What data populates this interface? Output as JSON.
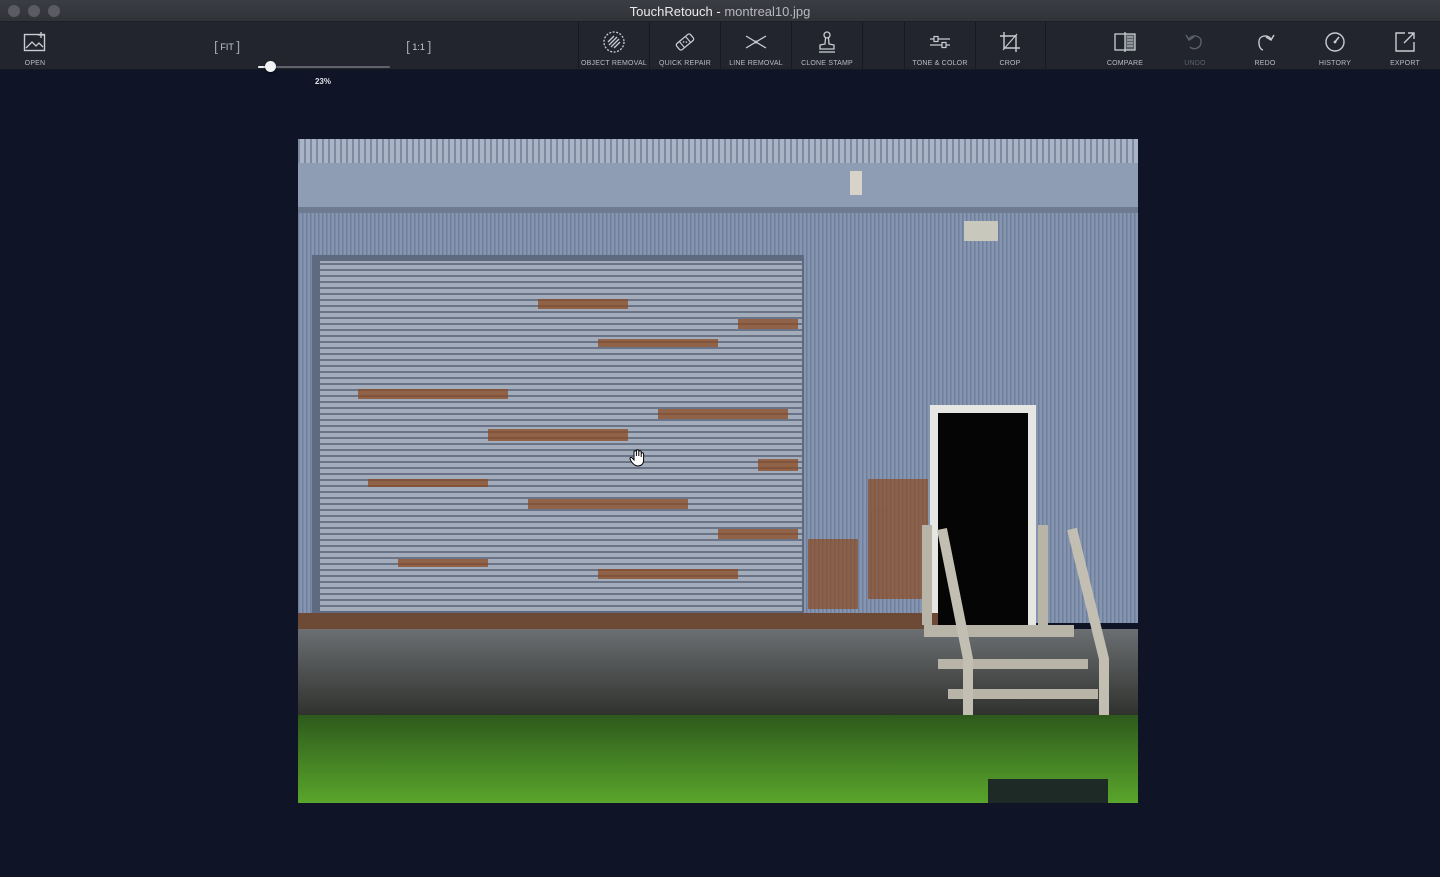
{
  "window": {
    "app_name": "TouchRetouch",
    "separator": " - ",
    "file_name": "montreal10.jpg"
  },
  "toolbar": {
    "open_label": "OPEN",
    "zoom": {
      "fit_label": "FIT",
      "one_to_one_label": "1:1",
      "percent_text": "23%",
      "percent_value": 23
    },
    "tools": [
      {
        "label": "OBJECT REMOVAL",
        "icon": "object-removal-icon"
      },
      {
        "label": "QUICK REPAIR",
        "icon": "quick-repair-icon"
      },
      {
        "label": "LINE REMOVAL",
        "icon": "line-removal-icon"
      },
      {
        "label": "CLONE STAMP",
        "icon": "clone-stamp-icon"
      }
    ],
    "tone_color_label": "TONE & COLOR",
    "crop_label": "CROP",
    "compare_label": "COMPARE",
    "undo_label": "UNDO",
    "undo_enabled": false,
    "redo_label": "REDO",
    "history_label": "HISTORY",
    "export_label": "EXPORT"
  },
  "colors": {
    "background": "#0f1526",
    "toolbar": "#22252e",
    "titlebar": "#313339"
  }
}
